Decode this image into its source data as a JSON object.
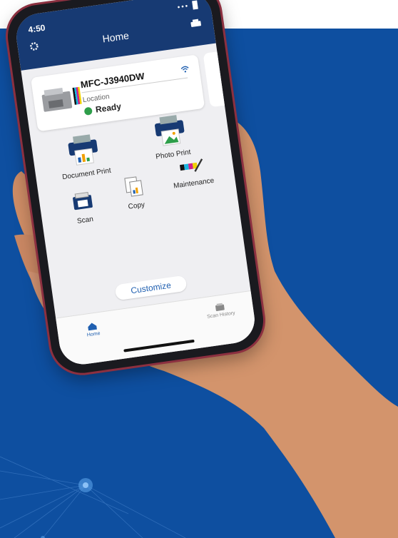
{
  "status_bar": {
    "time": "4:50"
  },
  "header": {
    "title": "Home"
  },
  "printer_card": {
    "model": "MFC-J3940DW",
    "location": "Location",
    "status": "Ready"
  },
  "tiles": [
    {
      "label": "Document Print"
    },
    {
      "label": "Photo Print"
    },
    {
      "label": "Scan"
    },
    {
      "label": "Copy"
    },
    {
      "label": "Maintenance"
    }
  ],
  "customize_label": "Customize",
  "tabs": {
    "home": "Home",
    "scan_history": "Scan History"
  },
  "colors": {
    "header": "#173a73",
    "background": "#0e4fa0",
    "accent": "#1f5fb0",
    "ready": "#2e9e4a"
  },
  "icons": [
    "gear-icon",
    "printer-icon",
    "wifi-icon",
    "document-print-icon",
    "photo-print-icon",
    "scan-icon",
    "copy-icon",
    "maintenance-icon",
    "home-icon",
    "scan-history-icon"
  ]
}
